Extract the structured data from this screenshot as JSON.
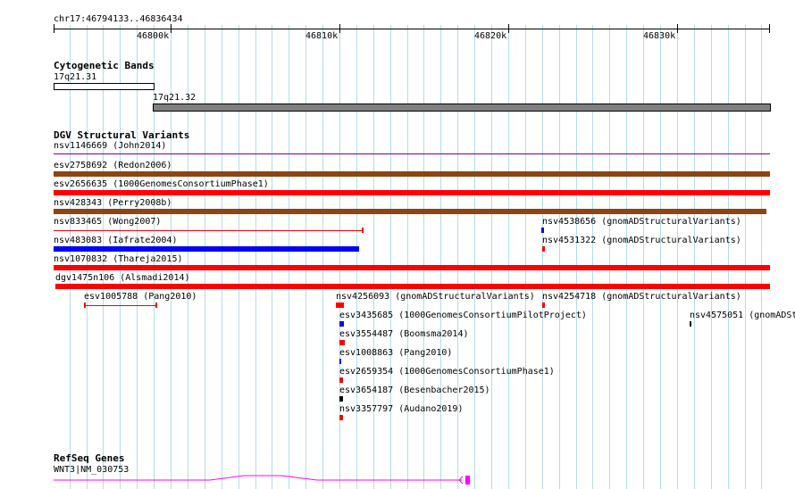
{
  "ruler": {
    "location": "chr17:46794133..46836434",
    "ticks": [
      "46800k",
      "46810k",
      "46820k",
      "46830k"
    ]
  },
  "cytoband": {
    "title": "Cytogenetic Bands",
    "band1": "17q21.31",
    "band2": "17q21.32"
  },
  "dgv": {
    "title": "DGV Structural Variants",
    "items": [
      "nsv1146669 (John2014)",
      "esv2758692 (Redon2006)",
      "esv2656635 (1000GenomesConsortiumPhase1)",
      "nsv428343 (Perry2008b)",
      "nsv833465 (Wong2007)",
      "nsv4538656 (gnomADStructuralVariants)",
      "nsv483083 (Iafrate2004)",
      "nsv4531322 (gnomADStructuralVariants)",
      "nsv1070832 (Thareja2015)",
      "dgv1475n106 (Alsmadi2014)",
      "esv1005788 (Pang2010)",
      "nsv4256093 (gnomADStructuralVariants)",
      "nsv4254718 (gnomADStructuralVariants)",
      "esv3435685 (1000GenomesConsortiumPilotProject)",
      "nsv4575051 (gnomADSt",
      "esv3554487 (Boomsma2014)",
      "esv1008863 (Pang2010)",
      "esv2659354 (1000GenomesConsortiumPhase1)",
      "esv3654187 (Besenbacher2015)",
      "nsv3357797 (Audano2019)"
    ]
  },
  "refseq": {
    "title": "RefSeq Genes",
    "gene": "WNT3|NM_030753"
  },
  "colors": {
    "grid": "#b3dde8",
    "brown": "#8b4513",
    "red": "#ff0000",
    "blue": "#0000ff",
    "purple": "#800080",
    "magenta": "#ff00ff",
    "band_gray": "#808080"
  }
}
